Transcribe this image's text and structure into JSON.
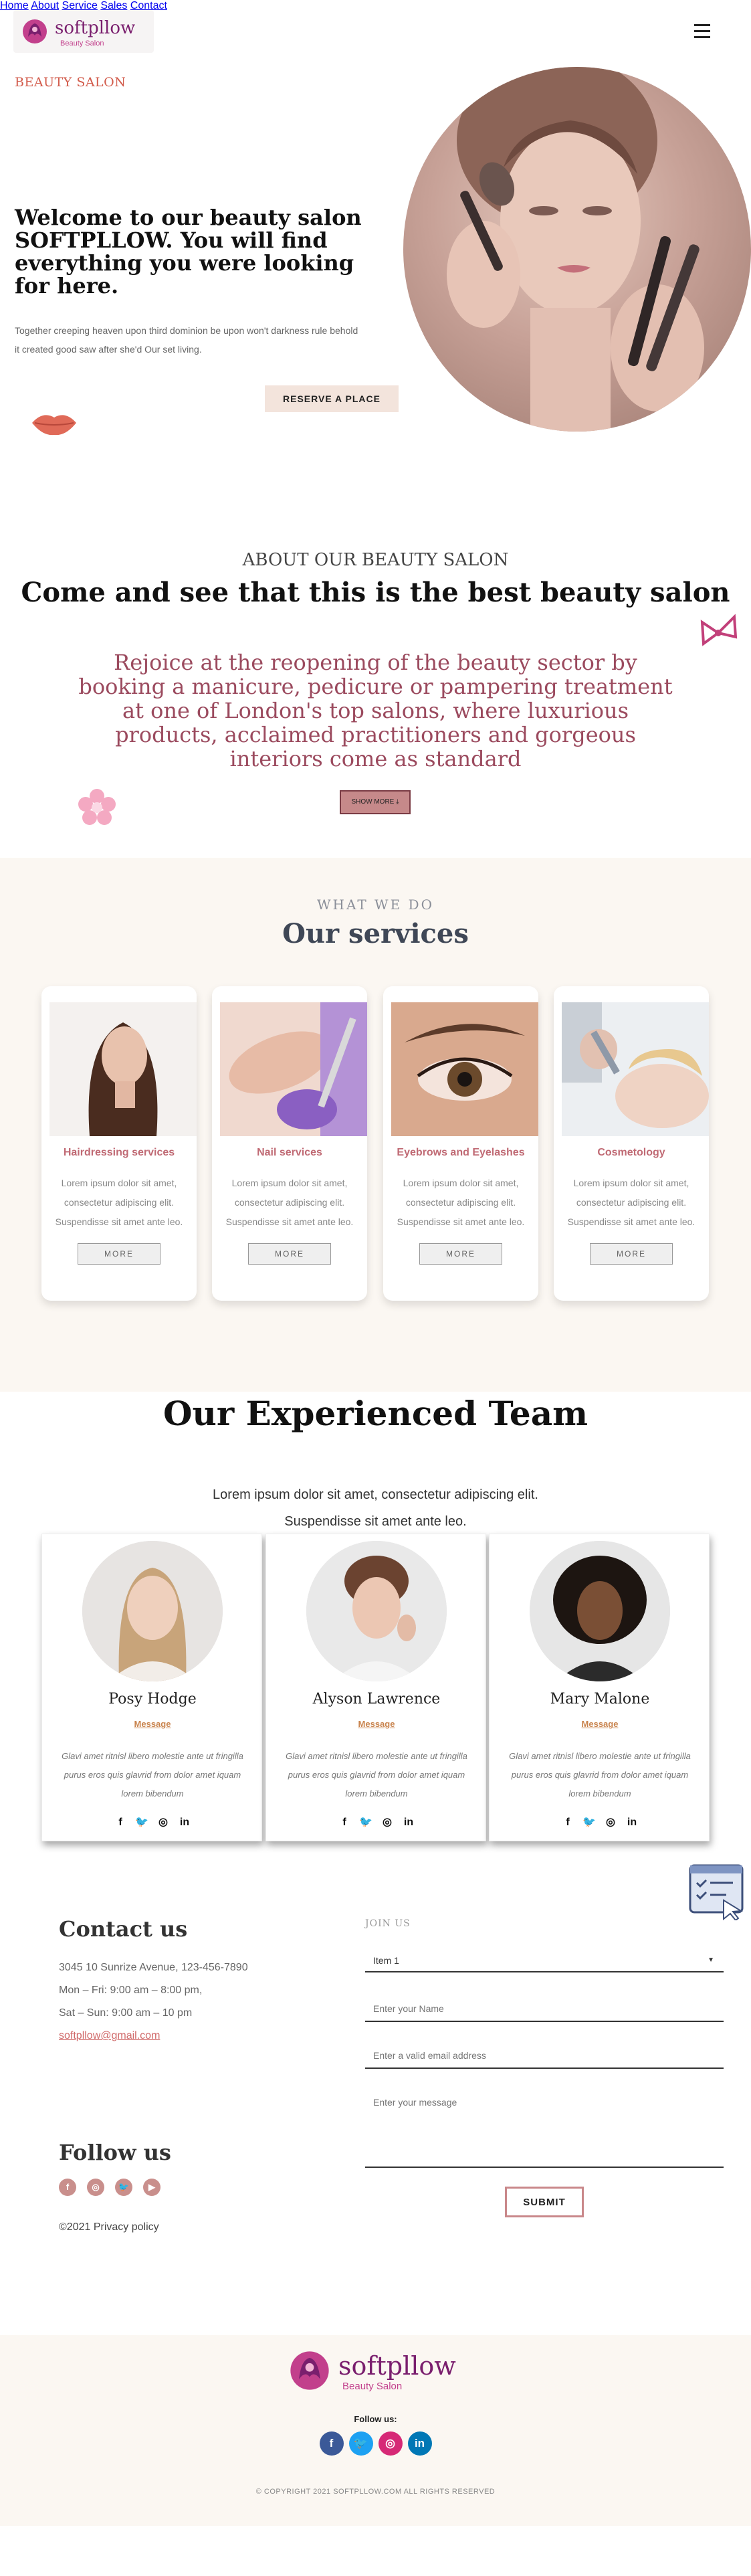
{
  "brand": {
    "name": "softpllow",
    "tagline": "Beauty Salon"
  },
  "nav": {
    "home": "Home",
    "about": "About",
    "service": "Service",
    "sales": "Sales",
    "contact": "Contact"
  },
  "hero": {
    "eyebrow": "BEAUTY SALON",
    "title": "Welcome to our beauty salon SOFTPLLOW. You will find everything you were looking for here.",
    "text": "Together creeping heaven upon third dominion be upon won't darkness rule behold it created good saw after she'd Our set living.",
    "button": "RESERVE A PLACE"
  },
  "about": {
    "eyebrow": "ABOUT OUR BEAUTY SALON",
    "title": "Come and see that this is the best beauty salon",
    "text": "Rejoice at the reopening of the beauty sector by booking a manicure, pedicure or pampering treatment at one of London's top salons, where luxurious products, acclaimed practitioners and gorgeous interiors come as standard",
    "button": "SHOW MORE ⤓"
  },
  "services": {
    "eyebrow": "WHAT WE DO",
    "title": "Our services",
    "items": [
      {
        "name": "Hairdressing services",
        "desc": "Lorem ipsum dolor sit amet, consectetur adipiscing elit. Suspendisse sit amet ante leo.",
        "button": "MORE"
      },
      {
        "name": "Nail services",
        "desc": "Lorem ipsum dolor sit amet, consectetur adipiscing elit. Suspendisse sit amet ante leo.",
        "button": "MORE"
      },
      {
        "name": "Eyebrows and Eyelashes",
        "desc": "Lorem ipsum dolor sit amet, consectetur adipiscing elit. Suspendisse sit amet ante leo.",
        "button": "MORE"
      },
      {
        "name": "Cosmetology",
        "desc": "Lorem ipsum dolor sit amet, consectetur adipiscing elit. Suspendisse sit amet ante leo.",
        "button": "MORE"
      }
    ]
  },
  "team": {
    "title": "Our Experienced Team",
    "subtitle_1": "Lorem ipsum dolor sit amet, consectetur adipiscing elit.",
    "subtitle_2": "Suspendisse sit amet ante leo.",
    "members": [
      {
        "name": "Posy Hodge",
        "link": "Message",
        "desc": "Glavi amet ritnisl libero molestie ante ut fringilla purus eros quis glavrid from dolor amet iquam lorem bibendum"
      },
      {
        "name": "Alyson Lawrence",
        "link": "Message",
        "desc": "Glavi amet ritnisl libero molestie ante ut fringilla purus eros quis glavrid from dolor amet iquam lorem bibendum"
      },
      {
        "name": "Mary Malone",
        "link": "Message",
        "desc": "Glavi amet ritnisl libero molestie ante ut fringilla purus eros quis glavrid from dolor amet iquam lorem bibendum"
      }
    ],
    "social": {
      "facebook": "f",
      "twitter": "🐦",
      "instagram": "◎",
      "linkedin": "in"
    }
  },
  "contact": {
    "title": "Contact us",
    "address": "3045 10 Sunrize Avenue, 123-456-7890",
    "hours_weekday": "Mon – Fri: 9:00 am – 8:00 pm,",
    "hours_weekend": "Sat – Sun: 9:00 am – 10 pm",
    "email": "softpllow@gmail.com",
    "follow_title": "Follow us",
    "privacy": "©2021 Privacy policy"
  },
  "form": {
    "label": "JOIN US",
    "select_value": "Item 1",
    "name_placeholder": "Enter your Name",
    "email_placeholder": "Enter a valid email address",
    "message_placeholder": "Enter your message",
    "submit": "SUBMIT"
  },
  "footer": {
    "follow": "Follow us:",
    "copyright": "© COPYRIGHT 2021 SOFTPLLOW.COM ALL RIGHTS RESERVED"
  },
  "colors": {
    "accent": "#c9888a",
    "brand": "#7a1f6e",
    "footer_bg": "#fbf7f2"
  },
  "icons": [
    "logo-icon",
    "menu-icon",
    "lips-icon",
    "bow-icon",
    "flower-icon",
    "checklist-icon",
    "facebook-icon",
    "twitter-icon",
    "instagram-icon",
    "youtube-icon",
    "linkedin-icon"
  ]
}
